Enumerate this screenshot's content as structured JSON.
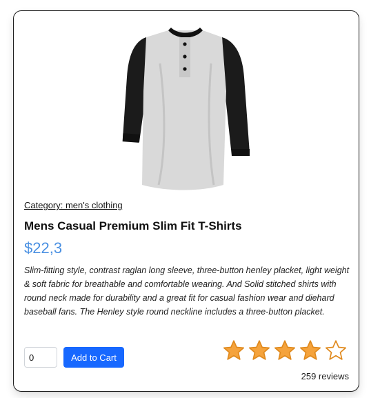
{
  "product": {
    "category_label": "Category: men's clothing",
    "title": "Mens Casual Premium Slim Fit T-Shirts",
    "price": "$22,3",
    "description": "Slim-fitting style, contrast raglan long sleeve, three-button henley placket, light weight & soft fabric for breathable and comfortable wearing. And Solid stitched shirts with round neck made for durability and a great fit for casual fashion wear and diehard baseball fans. The Henley style round neckline includes a three-button placket.",
    "image_icon": "henley-raglan-shirt-image"
  },
  "cart": {
    "quantity_value": "0",
    "add_button_label": "Add to Cart"
  },
  "rating": {
    "stars_filled": 4,
    "stars_total": 5,
    "reviews_label": "259 reviews",
    "star_color": "#f5a33c",
    "star_stroke": "#e08a1e"
  },
  "colors": {
    "price": "#4a90e2",
    "button": "#1768ff"
  }
}
